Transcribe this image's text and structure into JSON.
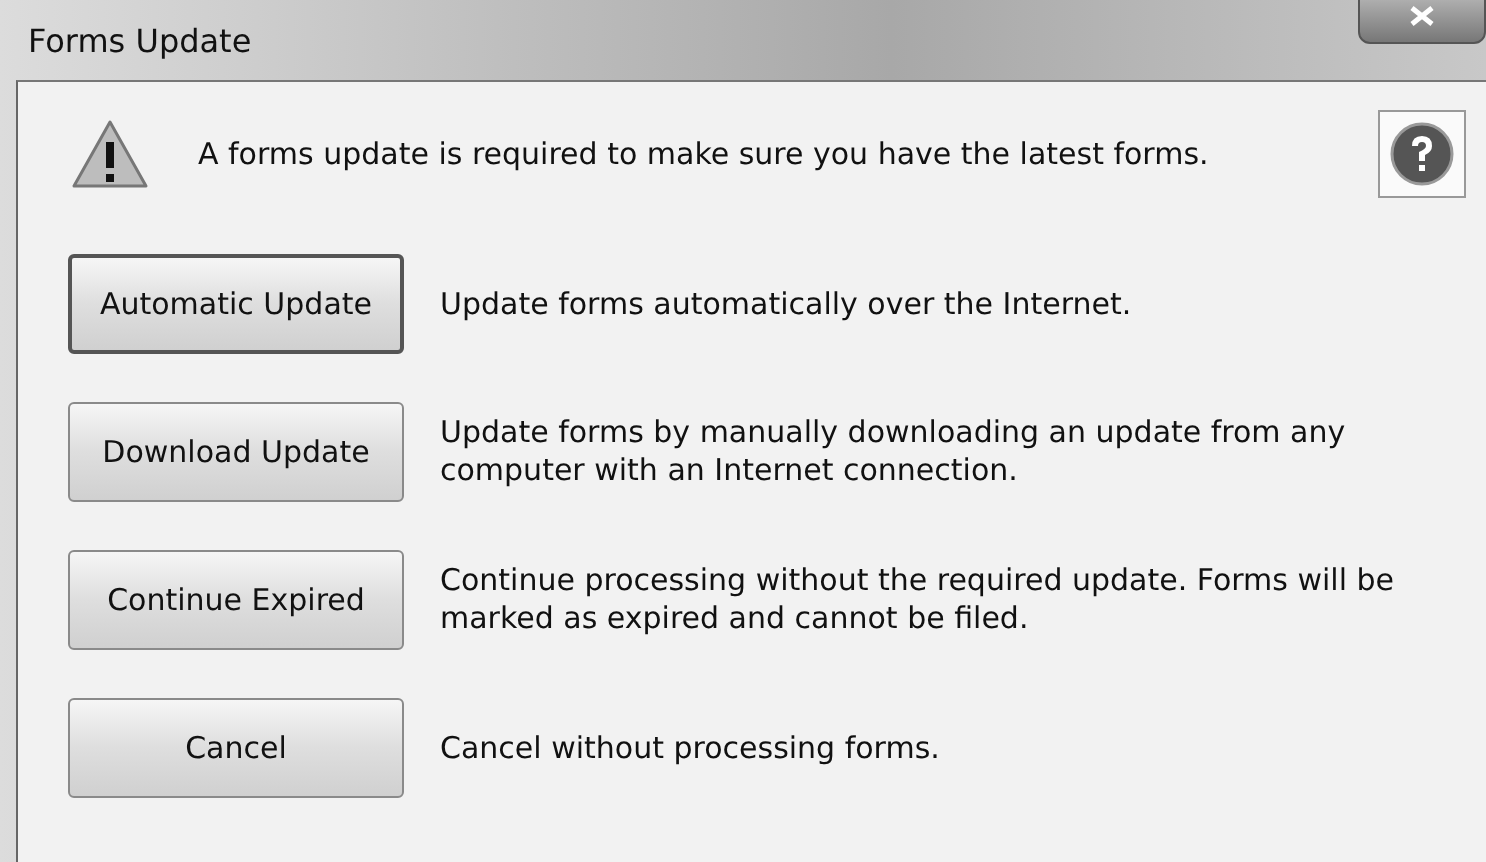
{
  "window": {
    "title": "Forms Update"
  },
  "message": "A forms update is required to make sure you have the latest forms.",
  "options": [
    {
      "button": "Automatic Update",
      "default": true,
      "description": "Update forms automatically over the Internet."
    },
    {
      "button": "Download Update",
      "default": false,
      "description": "Update forms by manually downloading an update from any computer with an Internet connection."
    },
    {
      "button": "Continue Expired",
      "default": false,
      "description": "Continue processing without the required update. Forms will be marked as expired and cannot be filed."
    },
    {
      "button": "Cancel",
      "default": false,
      "description": "Cancel without processing forms."
    }
  ]
}
